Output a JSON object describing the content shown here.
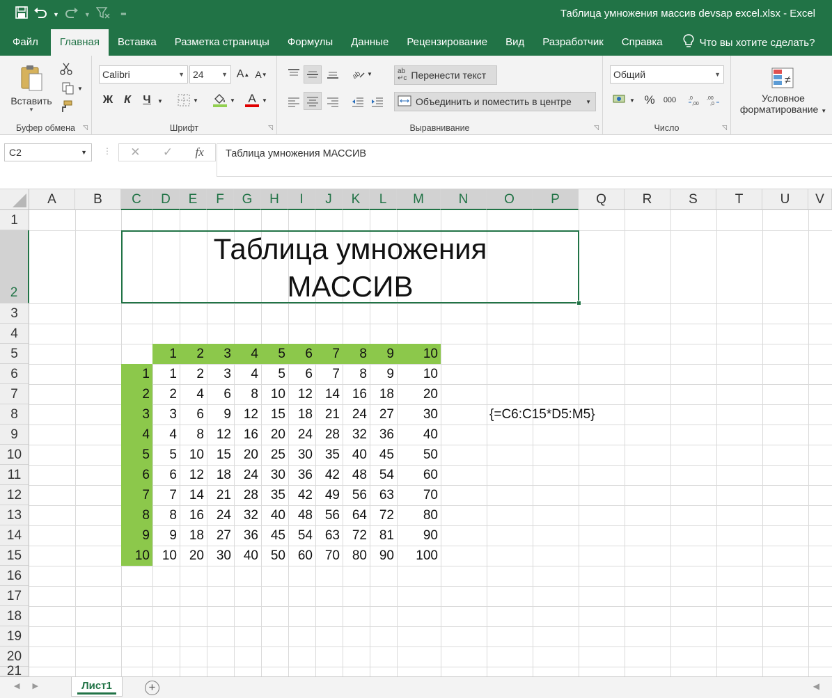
{
  "titlebar": {
    "title": "Таблица умножения массив devsap excel.xlsx  -  Excel",
    "qat": [
      "save-icon",
      "undo-icon",
      "dropdown-icon",
      "redo-icon",
      "dropdown-icon",
      "filter-clear-icon",
      "customize-icon"
    ]
  },
  "menu": {
    "items": [
      "Файл",
      "Главная",
      "Вставка",
      "Разметка страницы",
      "Формулы",
      "Данные",
      "Рецензирование",
      "Вид",
      "Разработчик",
      "Справка"
    ],
    "active_index": 1,
    "tell_me": "Что вы хотите сделать?"
  },
  "ribbon": {
    "clipboard": {
      "paste_label": "Вставить",
      "group_label": "Буфер обмена"
    },
    "font": {
      "font_name": "Calibri",
      "font_size": "24",
      "bold": "Ж",
      "italic": "К",
      "underline": "Ч",
      "grow": "A",
      "shrink": "A",
      "font_color_letter": "A",
      "group_label": "Шрифт"
    },
    "alignment": {
      "wrap_text": "Перенести текст",
      "merge_center": "Объединить и поместить в центре",
      "group_label": "Выравнивание"
    },
    "number": {
      "format": "Общий",
      "percent": "%",
      "thousands": "000",
      "group_label": "Число"
    },
    "styles": {
      "conditional_line1": "Условное",
      "conditional_line2": "форматирование"
    }
  },
  "formula_bar": {
    "name_box": "C2",
    "formula": "Таблица умножения МАССИВ"
  },
  "sheet": {
    "columns": [
      "A",
      "B",
      "C",
      "D",
      "E",
      "F",
      "G",
      "H",
      "I",
      "J",
      "K",
      "L",
      "M",
      "N",
      "O",
      "P",
      "Q",
      "R",
      "S",
      "T",
      "U",
      "V"
    ],
    "selected_columns": [
      "C",
      "D",
      "E",
      "F",
      "G",
      "H",
      "I",
      "J",
      "K",
      "L",
      "M",
      "N",
      "O",
      "P"
    ],
    "rows": [
      "1",
      "2",
      "3",
      "4",
      "5",
      "6",
      "7",
      "8",
      "9",
      "10",
      "11",
      "12",
      "13",
      "14",
      "15",
      "16",
      "17",
      "18",
      "19",
      "20",
      "21"
    ],
    "selected_row": "2",
    "merged_title_line1": "Таблица умножения",
    "merged_title_line2": "МАССИВ",
    "header_row": [
      "1",
      "2",
      "3",
      "4",
      "5",
      "6",
      "7",
      "8",
      "9",
      "10"
    ],
    "row_headers": [
      "1",
      "2",
      "3",
      "4",
      "5",
      "6",
      "7",
      "8",
      "9",
      "10"
    ],
    "table": [
      [
        "1",
        "2",
        "3",
        "4",
        "5",
        "6",
        "7",
        "8",
        "9",
        "10"
      ],
      [
        "2",
        "4",
        "6",
        "8",
        "10",
        "12",
        "14",
        "16",
        "18",
        "20"
      ],
      [
        "3",
        "6",
        "9",
        "12",
        "15",
        "18",
        "21",
        "24",
        "27",
        "30"
      ],
      [
        "4",
        "8",
        "12",
        "16",
        "20",
        "24",
        "28",
        "32",
        "36",
        "40"
      ],
      [
        "5",
        "10",
        "15",
        "20",
        "25",
        "30",
        "35",
        "40",
        "45",
        "50"
      ],
      [
        "6",
        "12",
        "18",
        "24",
        "30",
        "36",
        "42",
        "48",
        "54",
        "60"
      ],
      [
        "7",
        "14",
        "21",
        "28",
        "35",
        "42",
        "49",
        "56",
        "63",
        "70"
      ],
      [
        "8",
        "16",
        "24",
        "32",
        "40",
        "48",
        "56",
        "64",
        "72",
        "80"
      ],
      [
        "9",
        "18",
        "27",
        "36",
        "45",
        "54",
        "63",
        "72",
        "81",
        "90"
      ],
      [
        "10",
        "20",
        "30",
        "40",
        "50",
        "60",
        "70",
        "80",
        "90",
        "100"
      ]
    ],
    "array_formula_note": "{=C6:C15*D5:M5}",
    "highlight_color": "#8cc84b"
  },
  "sheet_tabs": {
    "active": "Лист1",
    "add_label": "+"
  },
  "colors": {
    "accent": "#217346"
  }
}
